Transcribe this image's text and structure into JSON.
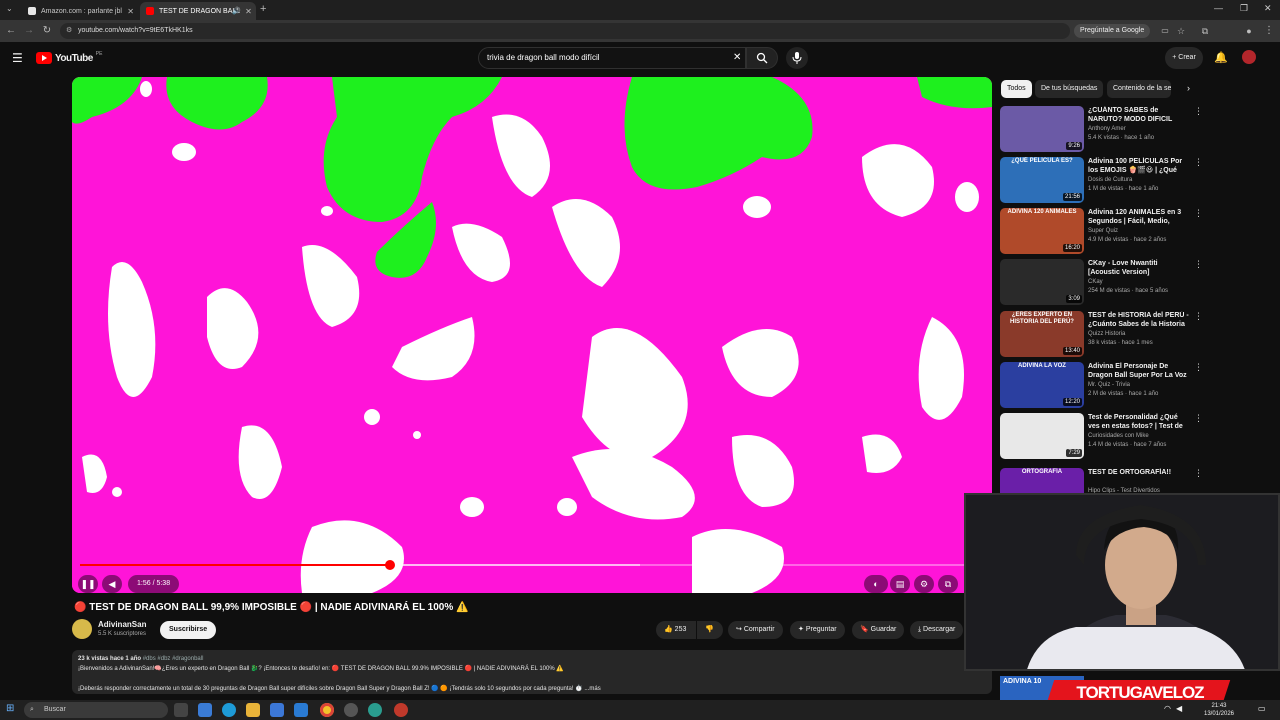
{
  "browser": {
    "tabs": [
      {
        "label": "Amazon.com : parlante jbl",
        "active": false
      },
      {
        "label": "TEST DE DRAGON BALL",
        "active": true
      }
    ],
    "url": "youtube.com/watch?v=9tE6TkHK1ks",
    "google_button": "Pregúntale a Google"
  },
  "youtube": {
    "logo": "YouTube",
    "logo_region": "PE",
    "search_value": "trivia de dragon ball modo difícil",
    "create_label": "Crear"
  },
  "player": {
    "time_label": "1:56 / 5:38",
    "progress": 0.343,
    "loaded": 0.62,
    "state": "playing"
  },
  "video": {
    "title": "🔴 TEST DE DRAGON BALL 99,9% IMPOSIBLE 🔴 | NADIE ADIVINARÁ EL 100% ⚠️",
    "channel": "AdivinanSan",
    "subscribers": "5.5 K suscriptores",
    "subscribe_label": "Suscribirse",
    "likes": "253",
    "share_label": "Compartir",
    "ask_label": "Preguntar",
    "save_label": "Guardar",
    "download_label": "Descargar",
    "desc_meta": "23 k vistas  hace 1 año",
    "desc_tags": "#dbs #dbz #dragonball",
    "desc_line1": "¡Bienvenidos a AdivinanSan!🧠¿Eres un experto en Dragon Ball 🐉? ¡Entonces te desafío! en: 🔴 TEST DE DRAGON BALL 99.9% IMPOSIBLE 🔴 | NADIE ADIVINARÁ EL 100% ⚠️",
    "desc_line2": "¡Deberás responder correctamente un total de 30 preguntas de Dragon Ball super difíciles sobre Dragon Ball Super y Dragon Ball Z! 🔵 🟠 ¡Tendrás solo 10 segundos por cada pregunta! ⏱️ ...más"
  },
  "filters": [
    "Todos",
    "De tus búsquedas",
    "Contenido de la se"
  ],
  "recommendations": [
    {
      "title": "¿CUÁNTO SABES de NARUTO? MODO DIFICIL",
      "channel": "Anthony Amer",
      "meta": "5.4 K vistas · hace 1 año",
      "duration": "9:26",
      "thumb_text": "",
      "color": "#6b5aa6"
    },
    {
      "title": "Adivina 100 PELÍCULAS Por los EMOJIS 🍿🎬😃 | ¿Qué tanto ...",
      "channel": "Dosis de Cultura",
      "meta": "1 M de vistas · hace 1 año",
      "duration": "21:56",
      "thumb_text": "¿QUÉ PELÍCULA ES?",
      "color": "#2d6fb8"
    },
    {
      "title": "Adivina 120 ANIMALES en 3 Segundos | Fácil, Medio, Difícil...",
      "channel": "Super Quiz",
      "meta": "4.9 M de vistas · hace 2 años",
      "duration": "16:20",
      "thumb_text": "ADIVINA 120 ANIMALES",
      "color": "#b04a2a"
    },
    {
      "title": "CKay - Love Nwantiti [Acoustic Version]",
      "channel": "CKay",
      "meta": "254 M de vistas · hace 5 años",
      "duration": "3:09",
      "thumb_text": "",
      "color": "#2a2a2a"
    },
    {
      "title": "TEST de HISTORIA del PERÚ - ¿Cuánto Sabes de la Historia ...",
      "channel": "Quizz Historia",
      "meta": "38 k vistas · hace 1 mes",
      "duration": "13:40",
      "thumb_text": "¿ERES EXPERTO EN HISTORIA DEL PERÚ?",
      "color": "#8a3a2a"
    },
    {
      "title": "Adivina El Personaje De Dragon Ball Super Por La Voz 🐉🔊 ...",
      "channel": "Mr. Quiz - Trivia",
      "meta": "2 M de vistas · hace 1 año",
      "duration": "12:20",
      "thumb_text": "ADIVINA LA VOZ",
      "color": "#2b3fa0"
    },
    {
      "title": "Test de Personalidad ¿Qué ves en estas fotos? | Test de ...",
      "channel": "Curiosidades con Mike",
      "meta": "1.4 M de vistas · hace 7 años",
      "duration": "7:29",
      "thumb_text": "",
      "color": "#e8e8e8"
    },
    {
      "title": "TEST DE ORTOGRAFÍA!!",
      "channel": "Hipo Clips - Test Divertidos",
      "meta": "Playlist",
      "duration": "",
      "thumb_text": "ORTOGRAFÍA",
      "color": "#6a1fa8"
    }
  ],
  "overlay": {
    "streamer_name": "TORTUGAVELOZ",
    "partial_text": "ADIVINA 10"
  },
  "taskbar": {
    "search_placeholder": "Buscar",
    "time": "21:43",
    "date": "13/01/2026"
  },
  "colors": {
    "video_bg": "#ff14d8",
    "blob_green": "#1ef01e",
    "progress_red": "#ff0000"
  }
}
